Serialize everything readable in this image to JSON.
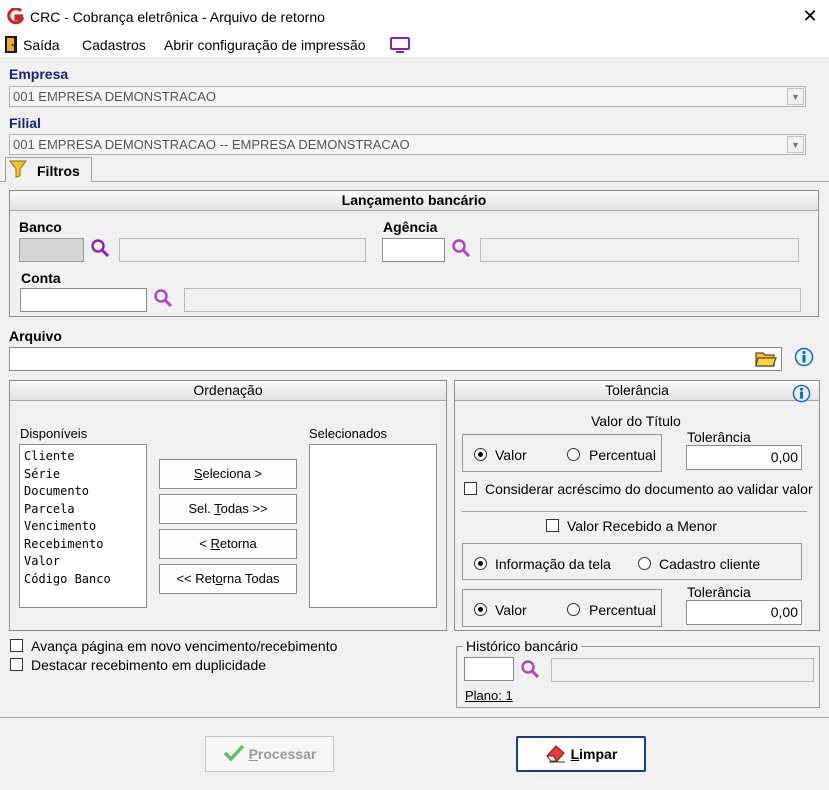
{
  "window": {
    "title": "CRC - Cobrança eletrônica - Arquivo de retorno",
    "close_glyph": "✕"
  },
  "menu": {
    "items": [
      {
        "label": "Saída",
        "icon": "exit-door-icon"
      },
      {
        "label": "Cadastros"
      },
      {
        "label": "Abrir configuração de impressão",
        "icon": "monitor-icon"
      }
    ]
  },
  "empresa": {
    "label": "Empresa",
    "value": "001 EMPRESA DEMONSTRACAO"
  },
  "filial": {
    "label": "Filial",
    "value": "001 EMPRESA DEMONSTRACAO -- EMPRESA DEMONSTRACAO"
  },
  "tab": {
    "label": "Filtros",
    "icon": "filter-icon"
  },
  "lancamento": {
    "title": "Lançamento bancário",
    "banco_label": "Banco",
    "agencia_label": "Agência",
    "conta_label": "Conta"
  },
  "arquivo": {
    "label": "Arquivo",
    "value": ""
  },
  "ordenacao": {
    "title": "Ordenação",
    "disponiveis_label": "Disponíveis",
    "selecionados_label": "Selecionados",
    "disponiveis": [
      "Cliente",
      "Série",
      "Documento",
      "Parcela",
      "Vencimento",
      "Recebimento",
      "Valor",
      "Código Banco"
    ],
    "btn_seleciona": {
      "pre": "",
      "u": "S",
      "post": "eleciona >"
    },
    "btn_sel_todas": {
      "pre": "Sel. ",
      "u": "T",
      "post": "odas >>"
    },
    "btn_retorna": {
      "pre": "< ",
      "u": "R",
      "post": "etorna"
    },
    "btn_retorna_todas": {
      "pre": "<< Ret",
      "u": "o",
      "post": "rna Todas"
    }
  },
  "tolerancia": {
    "title": "Tolerância",
    "valor_titulo_label": "Valor do Título",
    "tolerancia_label": "Tolerância",
    "radio_valor": "Valor",
    "radio_percentual": "Percentual",
    "tolerancia_value_1": "0,00",
    "considerar_label": "Considerar acréscimo do documento ao validar valor",
    "valor_recebido_label": "Valor Recebido a Menor",
    "radio_info_tela": "Informação da tela",
    "radio_cadastro_cliente": "Cadastro cliente",
    "tolerancia_value_2": "0,00"
  },
  "options": {
    "avanca_label": "Avança página em novo vencimento/recebimento",
    "destacar_label": "Destacar recebimento em duplicidade"
  },
  "historico": {
    "title": "Histórico bancário",
    "plano_label": "Plano: 1"
  },
  "footer": {
    "processar": {
      "u": "P",
      "post": "rocessar"
    },
    "limpar": {
      "u": "L",
      "post": "impar"
    }
  },
  "colors": {
    "blue_label": "#1a237e",
    "magnifier": "#8e24aa",
    "info_blue": "#1565c0",
    "check_green": "#43a047",
    "eraser_red": "#d32f2f",
    "logo_red": "#c62828"
  }
}
